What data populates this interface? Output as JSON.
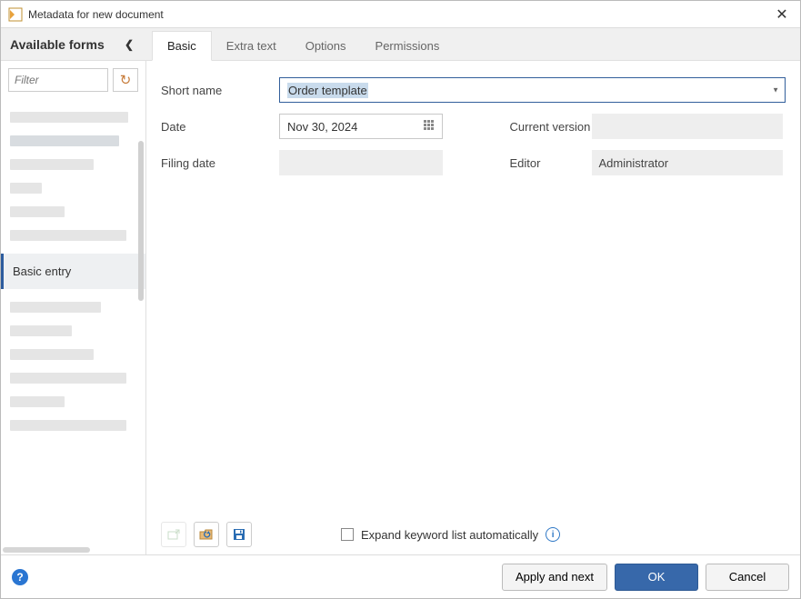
{
  "dialog": {
    "title": "Metadata for new document"
  },
  "sidebar": {
    "header": "Available forms",
    "filter_placeholder": "Filter",
    "selected_item": "Basic entry"
  },
  "tabs": [
    {
      "label": "Basic",
      "active": true
    },
    {
      "label": "Extra text",
      "active": false
    },
    {
      "label": "Options",
      "active": false
    },
    {
      "label": "Permissions",
      "active": false
    }
  ],
  "form": {
    "short_name_label": "Short name",
    "short_name_value": "Order template",
    "date_label": "Date",
    "date_value": "Nov 30, 2024",
    "current_version_label": "Current version",
    "current_version_value": "",
    "filing_date_label": "Filing date",
    "filing_date_value": "",
    "editor_label": "Editor",
    "editor_value": "Administrator"
  },
  "checkbox": {
    "label": "Expand keyword list automatically"
  },
  "footer": {
    "apply_next": "Apply and next",
    "ok": "OK",
    "cancel": "Cancel"
  }
}
